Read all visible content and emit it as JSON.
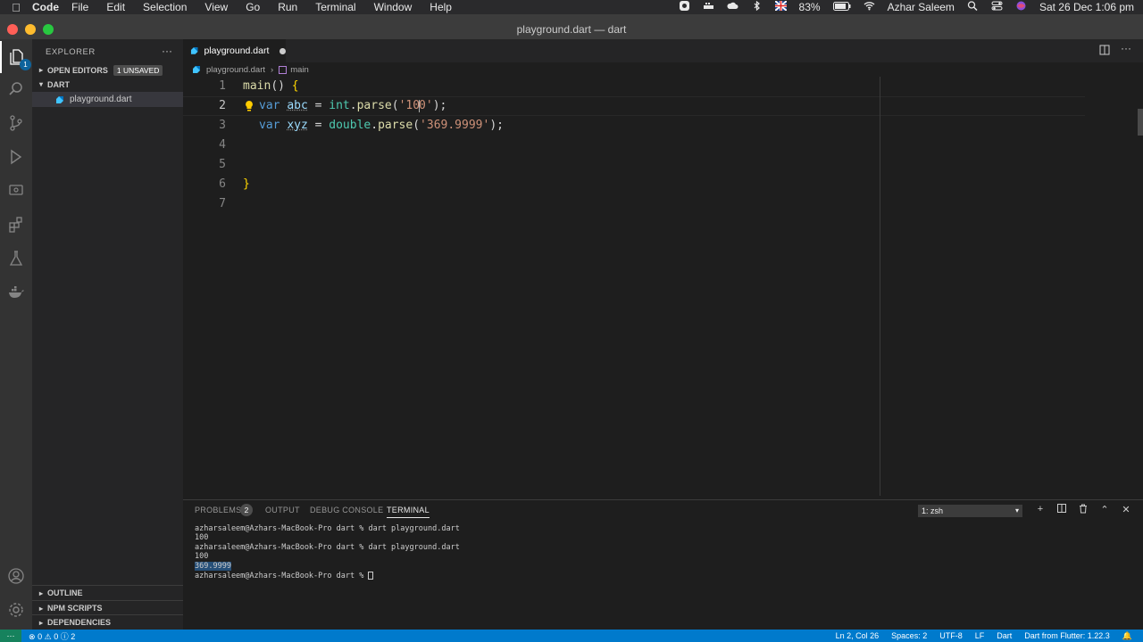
{
  "menubar": {
    "app": "Code",
    "items": [
      "File",
      "Edit",
      "Selection",
      "View",
      "Go",
      "Run",
      "Terminal",
      "Window",
      "Help"
    ],
    "battery": "83%",
    "user": "Azhar Saleem",
    "datetime": "Sat 26 Dec  1:06 pm"
  },
  "window": {
    "title": "playground.dart — dart"
  },
  "sidebar": {
    "title": "EXPLORER",
    "open_editors": "OPEN EDITORS",
    "unsaved_badge": "1 UNSAVED",
    "folder": "DART",
    "file": "playground.dart",
    "outline": "OUTLINE",
    "npm_scripts": "NPM SCRIPTS",
    "dependencies": "DEPENDENCIES"
  },
  "activitybar": {
    "scm_badge": "1"
  },
  "editor": {
    "tab_label": "playground.dart",
    "breadcrumb_file": "playground.dart",
    "breadcrumb_symbol": "main",
    "line_numbers": [
      "1",
      "2",
      "3",
      "4",
      "5",
      "6",
      "7"
    ],
    "lines": {
      "l1_fn": "main",
      "l1_rest": "() ",
      "l1_brace": "{",
      "kw_var": "var",
      "l2_name": "abc",
      "eq": " = ",
      "l2_type": "int",
      "dot": ".",
      "parse": "parse",
      "paren_open": "(",
      "l2_str_a": "'10",
      "l2_str_b": "0'",
      "paren_close_semi": ");",
      "l3_name": "xyz",
      "l3_type": "double",
      "l3_str": "'369.9999'",
      "l6_brace": "}"
    }
  },
  "panel": {
    "tabs": [
      "PROBLEMS",
      "OUTPUT",
      "DEBUG CONSOLE",
      "TERMINAL"
    ],
    "problems_count": "2",
    "shell": "1: zsh",
    "terminal_lines": [
      "azharsaleem@Azhars-MacBook-Pro dart % dart playground.dart",
      "100",
      "azharsaleem@Azhars-MacBook-Pro dart % dart playground.dart",
      "100",
      "369.9999",
      "azharsaleem@Azhars-MacBook-Pro dart % "
    ]
  },
  "statusbar": {
    "errors": "0",
    "warnings": "0",
    "infos": "2",
    "position": "Ln 2, Col 26",
    "spaces": "Spaces: 2",
    "encoding": "UTF-8",
    "eol": "LF",
    "language": "Dart",
    "sdk": "Dart from Flutter: 1.22.3"
  },
  "colors": {
    "statusbar": "#007acc",
    "editor_bg": "#1e1e1e",
    "sidebar_bg": "#252526",
    "keyword": "#569cd6",
    "string": "#ce9178"
  }
}
